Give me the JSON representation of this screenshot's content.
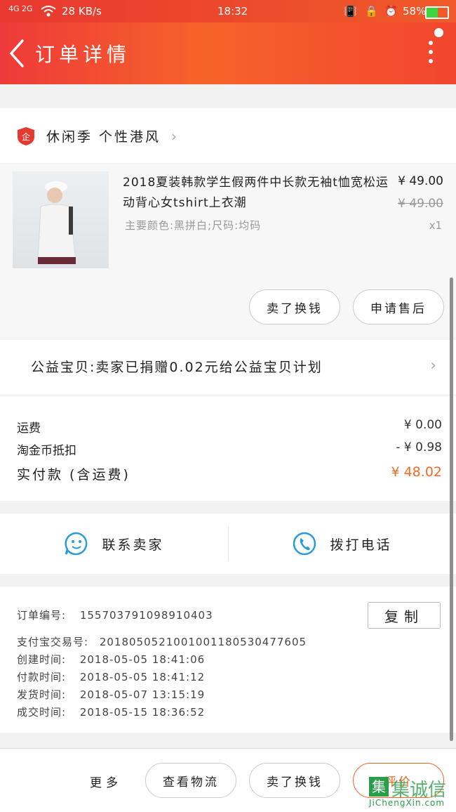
{
  "status_bar": {
    "network": "4G 2G",
    "speed": "28 KB/s",
    "time": "18:32",
    "battery": "58%"
  },
  "header": {
    "title": "订单详情"
  },
  "store": {
    "name": "休闲季 个性港风"
  },
  "item": {
    "title": "2018夏装韩款学生假两件中长款无袖t恤宽松运动背心女tshirt上衣潮",
    "spec": "主要颜色:黑拼白;尺码:均码",
    "price": "¥ 49.00",
    "original_price": "¥ 49.00",
    "qty": "x1",
    "buttons": [
      "卖了换钱",
      "申请售后"
    ]
  },
  "charity": {
    "text": "公益宝贝:卖家已捐赠0.02元给公益宝贝计划"
  },
  "fees": [
    {
      "label": "运费",
      "value": "¥ 0.00"
    },
    {
      "label": "淘金币抵扣",
      "value": "- ¥ 0.98"
    },
    {
      "label": "实付款 (含运费)",
      "value": "¥ 48.02"
    }
  ],
  "colors": {
    "accent": "#f5631f",
    "pay": "#f56a23",
    "contact_blue": "#2b9ad8",
    "brand_red": "#e53a30"
  },
  "contact": {
    "seller": "联系卖家",
    "phone": "拨打电话"
  },
  "order_info": {
    "copy": "复制",
    "rows": [
      {
        "label": "订单编号:",
        "value": "155703791098910403"
      },
      {
        "label": "支付宝交易号:",
        "value": "2018050521001001180530477605"
      },
      {
        "label": "创建时间:",
        "value": "2018-05-05 18:41:06"
      },
      {
        "label": "付款时间:",
        "value": "2018-05-05 18:41:12"
      },
      {
        "label": "发货时间:",
        "value": "2018-05-07 13:15:19"
      },
      {
        "label": "成交时间:",
        "value": "2018-05-15 18:36:52"
      }
    ]
  },
  "bottom": {
    "more": "更多",
    "logistics": "查看物流",
    "resell": "卖了换钱",
    "review": "评价"
  },
  "watermark": {
    "brand": "集诚信",
    "url": "JiChengXin.com",
    "logo": "集"
  }
}
